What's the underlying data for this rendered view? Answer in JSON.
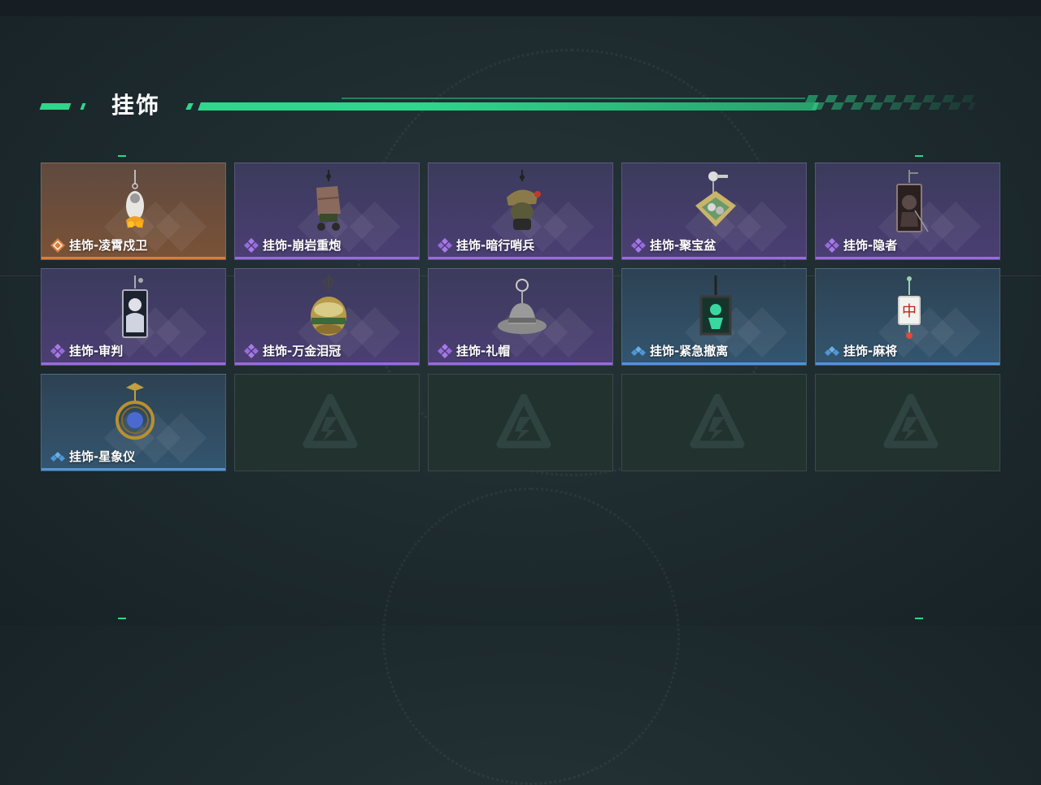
{
  "header": {
    "title": "挂饰"
  },
  "colors": {
    "accent": "#2fd68b",
    "orange": "#d77e3f",
    "purple": "#9a6ae0",
    "blue": "#4f96d8"
  },
  "items": [
    {
      "label": "挂饰-凌霄戍卫",
      "rarity": "orange",
      "icon": "guard-charm"
    },
    {
      "label": "挂饰-崩岩重炮",
      "rarity": "purple",
      "icon": "cannon-charm"
    },
    {
      "label": "挂饰-暗行哨兵",
      "rarity": "purple",
      "icon": "sentinel-charm"
    },
    {
      "label": "挂饰-聚宝盆",
      "rarity": "purple",
      "icon": "treasure-bowl-charm"
    },
    {
      "label": "挂饰-隐者",
      "rarity": "purple",
      "icon": "hermit-card-charm"
    },
    {
      "label": "挂饰-审判",
      "rarity": "purple",
      "icon": "judgement-card-charm"
    },
    {
      "label": "挂饰-万金泪冠",
      "rarity": "purple",
      "icon": "crown-charm"
    },
    {
      "label": "挂饰-礼帽",
      "rarity": "purple",
      "icon": "top-hat-charm"
    },
    {
      "label": "挂饰-紧急撤离",
      "rarity": "blue",
      "icon": "evac-sign-charm"
    },
    {
      "label": "挂饰-麻将",
      "rarity": "blue",
      "icon": "mahjong-tile-charm"
    },
    {
      "label": "挂饰-星象仪",
      "rarity": "blue",
      "icon": "astrolabe-charm"
    }
  ],
  "empty_slots": 4
}
